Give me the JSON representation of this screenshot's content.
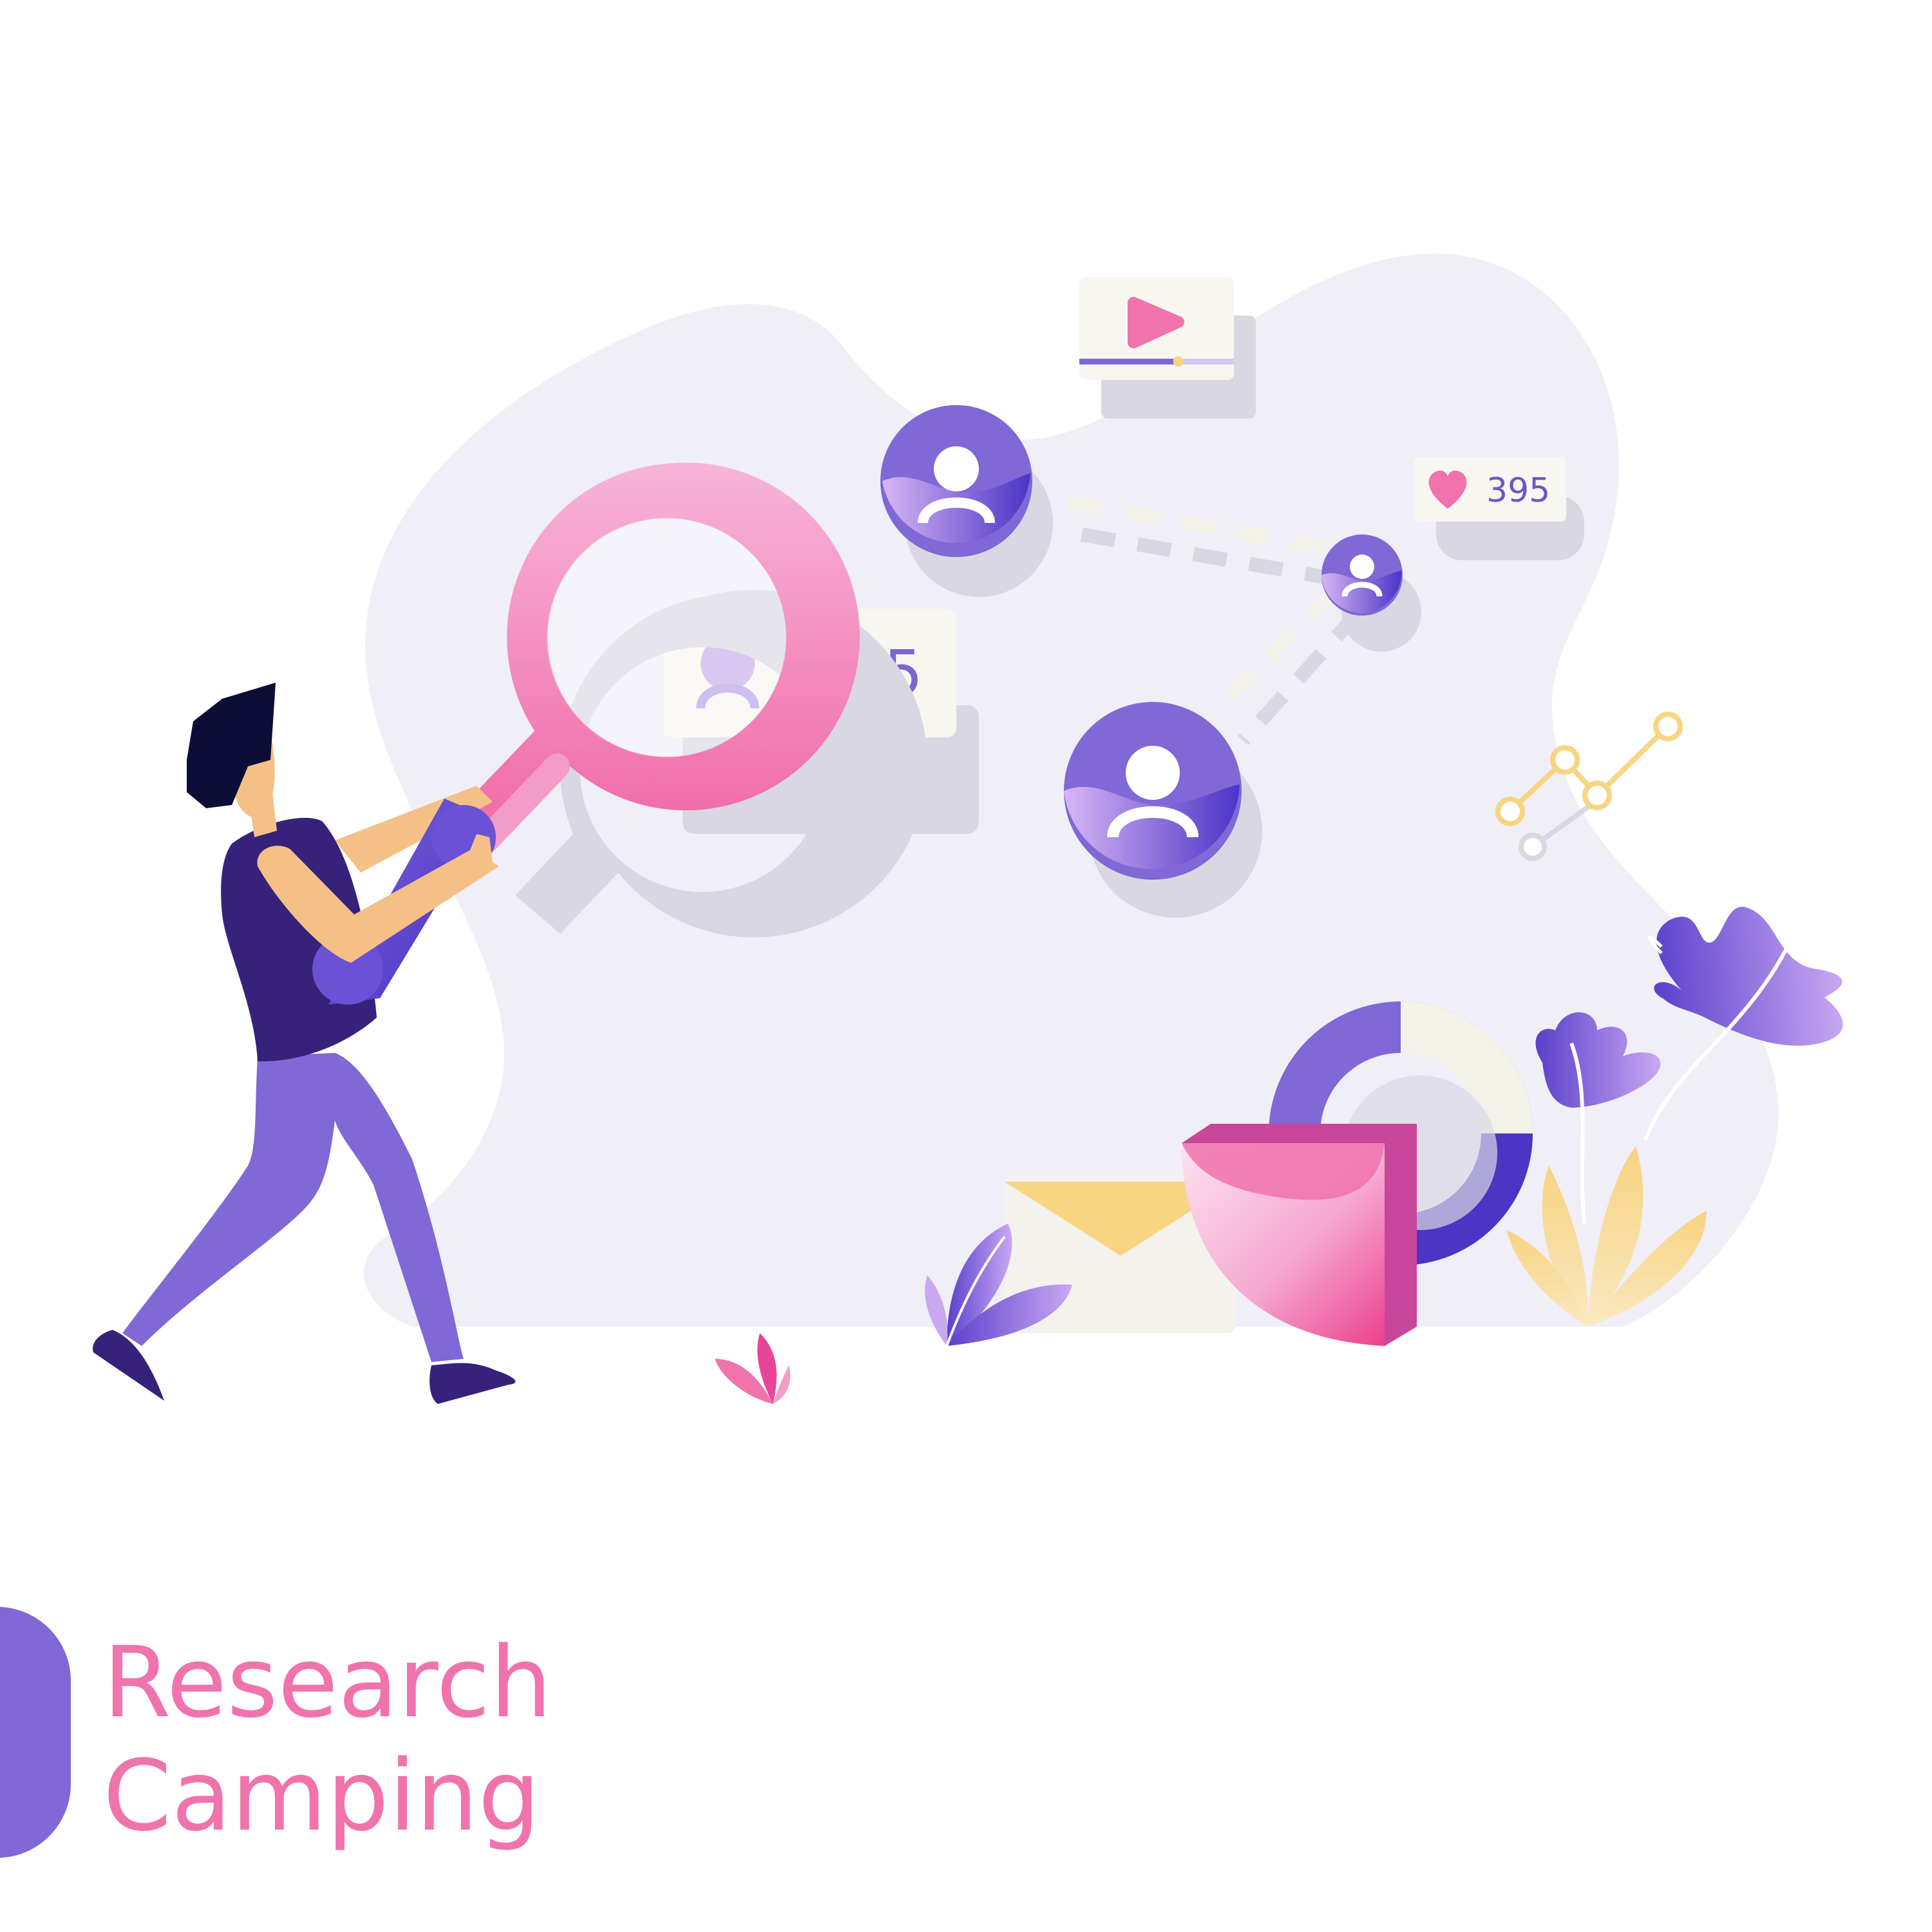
{
  "title": {
    "line1": "Research",
    "line2": "Camping"
  },
  "profile_card": {
    "count_text": "485"
  },
  "likes_card": {
    "count_text": "395",
    "icon": "heart-icon"
  },
  "video_card": {
    "icon": "play-icon",
    "progress": 0.64
  },
  "icons": {
    "magnifier": "magnifier-icon",
    "user": "user-icon",
    "envelope": "envelope-icon",
    "shield": "shield-icon",
    "donut": "donut-chart-icon",
    "line_chart": "line-chart-icon"
  },
  "colors": {
    "accent_pink": "#f073ac",
    "accent_purple": "#8068d6",
    "deep_purple": "#4c34c4",
    "background_blob": "#f0eef7",
    "shadow": "#d9d8e2",
    "yellow": "#f8d582",
    "card": "#f7f6f1"
  }
}
